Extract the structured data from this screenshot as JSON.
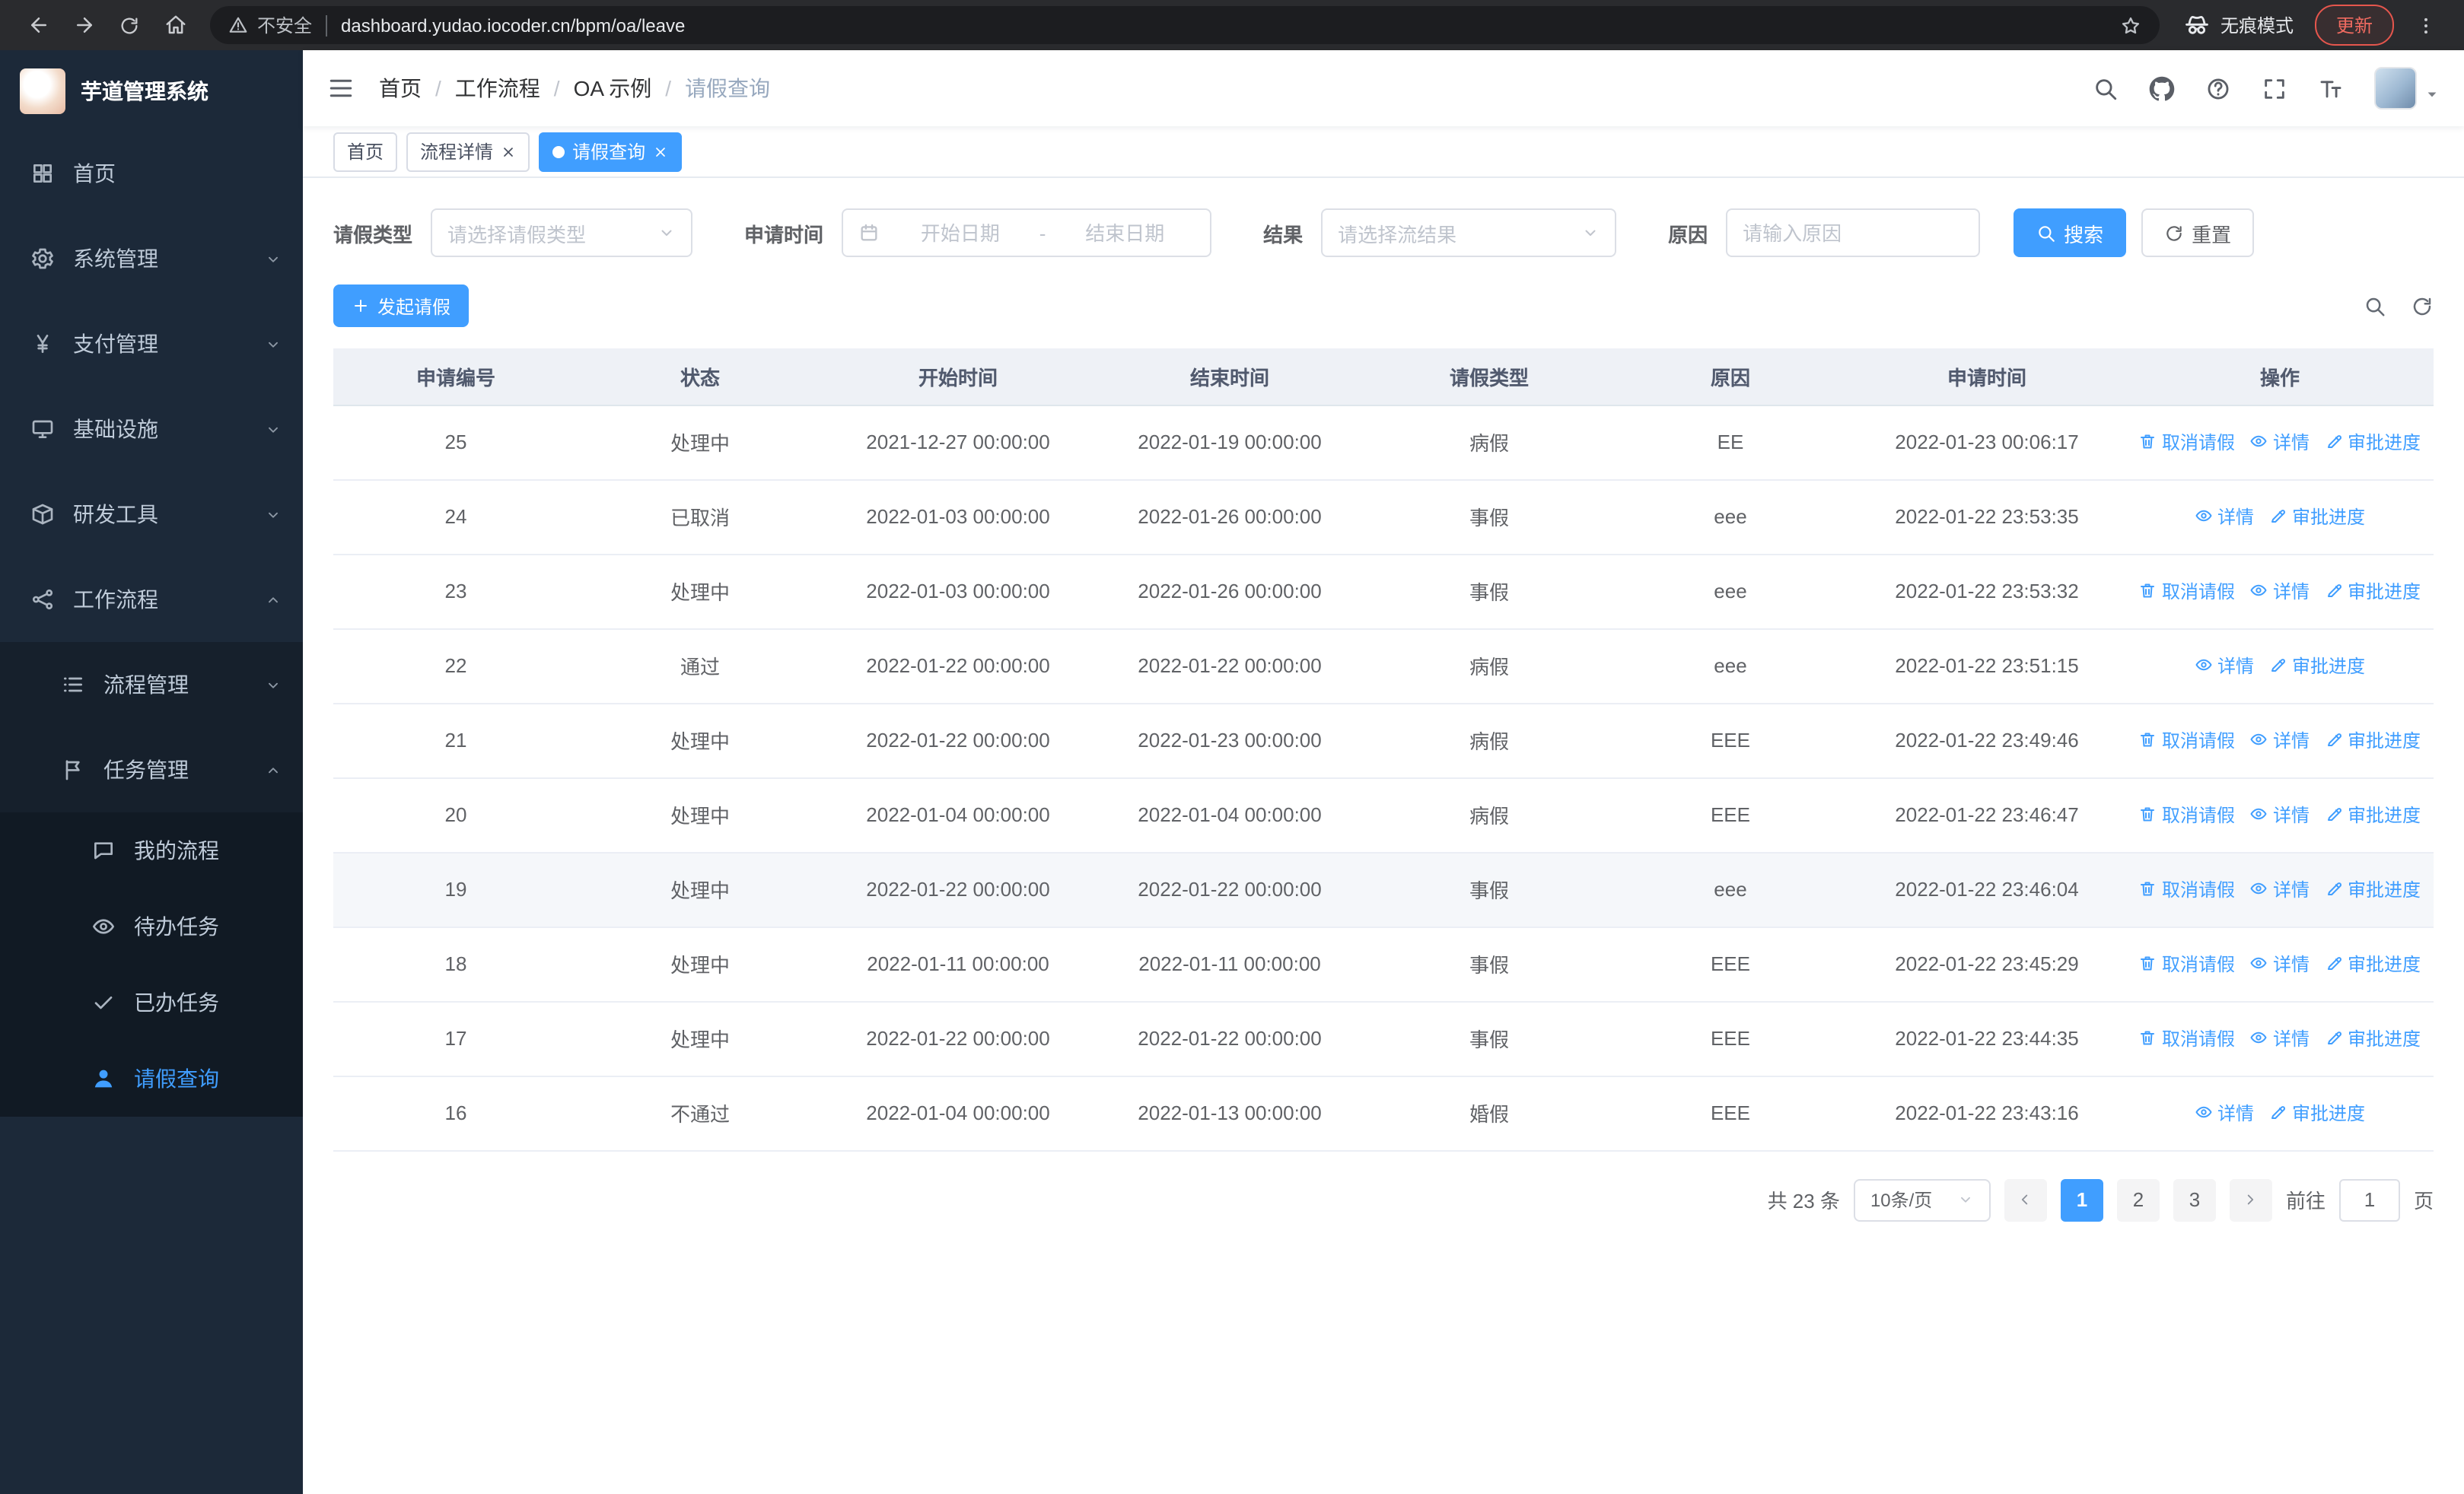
{
  "browser": {
    "security_label": "不安全",
    "url": "dashboard.yudao.iocoder.cn/bpm/oa/leave",
    "incognito_label": "无痕模式",
    "update_label": "更新"
  },
  "sidebar": {
    "logo_title": "芋道管理系统",
    "items": [
      {
        "label": "首页",
        "icon": "grid-icon",
        "arrow": null
      },
      {
        "label": "系统管理",
        "icon": "gear-icon",
        "arrow": "down"
      },
      {
        "label": "支付管理",
        "icon": "yen-icon",
        "arrow": "down"
      },
      {
        "label": "基础设施",
        "icon": "monitor-icon",
        "arrow": "down"
      },
      {
        "label": "研发工具",
        "icon": "box-icon",
        "arrow": "down"
      },
      {
        "label": "工作流程",
        "icon": "workflow-icon",
        "arrow": "up"
      }
    ],
    "workflow_children": [
      {
        "label": "流程管理",
        "icon": "list-icon",
        "arrow": "down"
      },
      {
        "label": "任务管理",
        "icon": "flag-icon",
        "arrow": "up"
      }
    ],
    "task_children": [
      {
        "label": "我的流程",
        "icon": "chat-icon",
        "active": false
      },
      {
        "label": "待办任务",
        "icon": "eye-icon",
        "active": false
      },
      {
        "label": "已办任务",
        "icon": "check-icon",
        "active": false
      },
      {
        "label": "请假查询",
        "icon": "person-icon",
        "active": true
      }
    ]
  },
  "navbar": {
    "breadcrumb": [
      {
        "label": "首页"
      },
      {
        "label": "工作流程"
      },
      {
        "label": "OA 示例"
      },
      {
        "label": "请假查询"
      }
    ]
  },
  "tags": [
    {
      "label": "首页",
      "closable": false,
      "active": false
    },
    {
      "label": "流程详情",
      "closable": true,
      "active": false
    },
    {
      "label": "请假查询",
      "closable": true,
      "active": true
    }
  ],
  "filters": {
    "leave_type_label": "请假类型",
    "leave_type_placeholder": "请选择请假类型",
    "apply_time_label": "申请时间",
    "start_date_placeholder": "开始日期",
    "range_separator": "-",
    "end_date_placeholder": "结束日期",
    "result_label": "结果",
    "result_placeholder": "请选择流结果",
    "reason_label": "原因",
    "reason_placeholder": "请输入原因",
    "search_label": "搜索",
    "reset_label": "重置"
  },
  "toolbar": {
    "create_label": "发起请假"
  },
  "table": {
    "headers": [
      "申请编号",
      "状态",
      "开始时间",
      "结束时间",
      "请假类型",
      "原因",
      "申请时间",
      "操作"
    ],
    "action_labels": {
      "cancel": "取消请假",
      "detail": "详情",
      "progress": "审批进度"
    },
    "action_icons": {
      "cancel": "delete-icon",
      "detail": "view-icon",
      "progress": "edit-icon"
    },
    "rows": [
      {
        "id": "25",
        "status": "处理中",
        "start": "2021-12-27 00:00:00",
        "end": "2022-01-19 00:00:00",
        "type": "病假",
        "reason": "EE",
        "applied": "2022-01-23 00:06:17",
        "actions": [
          "cancel",
          "detail",
          "progress"
        ],
        "highlighted": false
      },
      {
        "id": "24",
        "status": "已取消",
        "start": "2022-01-03 00:00:00",
        "end": "2022-01-26 00:00:00",
        "type": "事假",
        "reason": "eee",
        "applied": "2022-01-22 23:53:35",
        "actions": [
          "detail",
          "progress"
        ],
        "highlighted": false
      },
      {
        "id": "23",
        "status": "处理中",
        "start": "2022-01-03 00:00:00",
        "end": "2022-01-26 00:00:00",
        "type": "事假",
        "reason": "eee",
        "applied": "2022-01-22 23:53:32",
        "actions": [
          "cancel",
          "detail",
          "progress"
        ],
        "highlighted": false
      },
      {
        "id": "22",
        "status": "通过",
        "start": "2022-01-22 00:00:00",
        "end": "2022-01-22 00:00:00",
        "type": "病假",
        "reason": "eee",
        "applied": "2022-01-22 23:51:15",
        "actions": [
          "detail",
          "progress"
        ],
        "highlighted": false
      },
      {
        "id": "21",
        "status": "处理中",
        "start": "2022-01-22 00:00:00",
        "end": "2022-01-23 00:00:00",
        "type": "病假",
        "reason": "EEE",
        "applied": "2022-01-22 23:49:46",
        "actions": [
          "cancel",
          "detail",
          "progress"
        ],
        "highlighted": false
      },
      {
        "id": "20",
        "status": "处理中",
        "start": "2022-01-04 00:00:00",
        "end": "2022-01-04 00:00:00",
        "type": "病假",
        "reason": "EEE",
        "applied": "2022-01-22 23:46:47",
        "actions": [
          "cancel",
          "detail",
          "progress"
        ],
        "highlighted": false
      },
      {
        "id": "19",
        "status": "处理中",
        "start": "2022-01-22 00:00:00",
        "end": "2022-01-22 00:00:00",
        "type": "事假",
        "reason": "eee",
        "applied": "2022-01-22 23:46:04",
        "actions": [
          "cancel",
          "detail",
          "progress"
        ],
        "highlighted": true
      },
      {
        "id": "18",
        "status": "处理中",
        "start": "2022-01-11 00:00:00",
        "end": "2022-01-11 00:00:00",
        "type": "事假",
        "reason": "EEE",
        "applied": "2022-01-22 23:45:29",
        "actions": [
          "cancel",
          "detail",
          "progress"
        ],
        "highlighted": false
      },
      {
        "id": "17",
        "status": "处理中",
        "start": "2022-01-22 00:00:00",
        "end": "2022-01-22 00:00:00",
        "type": "事假",
        "reason": "EEE",
        "applied": "2022-01-22 23:44:35",
        "actions": [
          "cancel",
          "detail",
          "progress"
        ],
        "highlighted": false
      },
      {
        "id": "16",
        "status": "不通过",
        "start": "2022-01-04 00:00:00",
        "end": "2022-01-13 00:00:00",
        "type": "婚假",
        "reason": "EEE",
        "applied": "2022-01-22 23:43:16",
        "actions": [
          "detail",
          "progress"
        ],
        "highlighted": false
      }
    ]
  },
  "pagination": {
    "total_label": "共 23 条",
    "page_size": "10条/页",
    "pages": [
      "1",
      "2",
      "3"
    ],
    "current_page": "1",
    "goto_prefix": "前往",
    "goto_value": "1",
    "goto_suffix": "页"
  },
  "colors": {
    "primary": "#409eff",
    "sidebar_bg": "#1c2939",
    "update_badge": "#e5564d"
  }
}
